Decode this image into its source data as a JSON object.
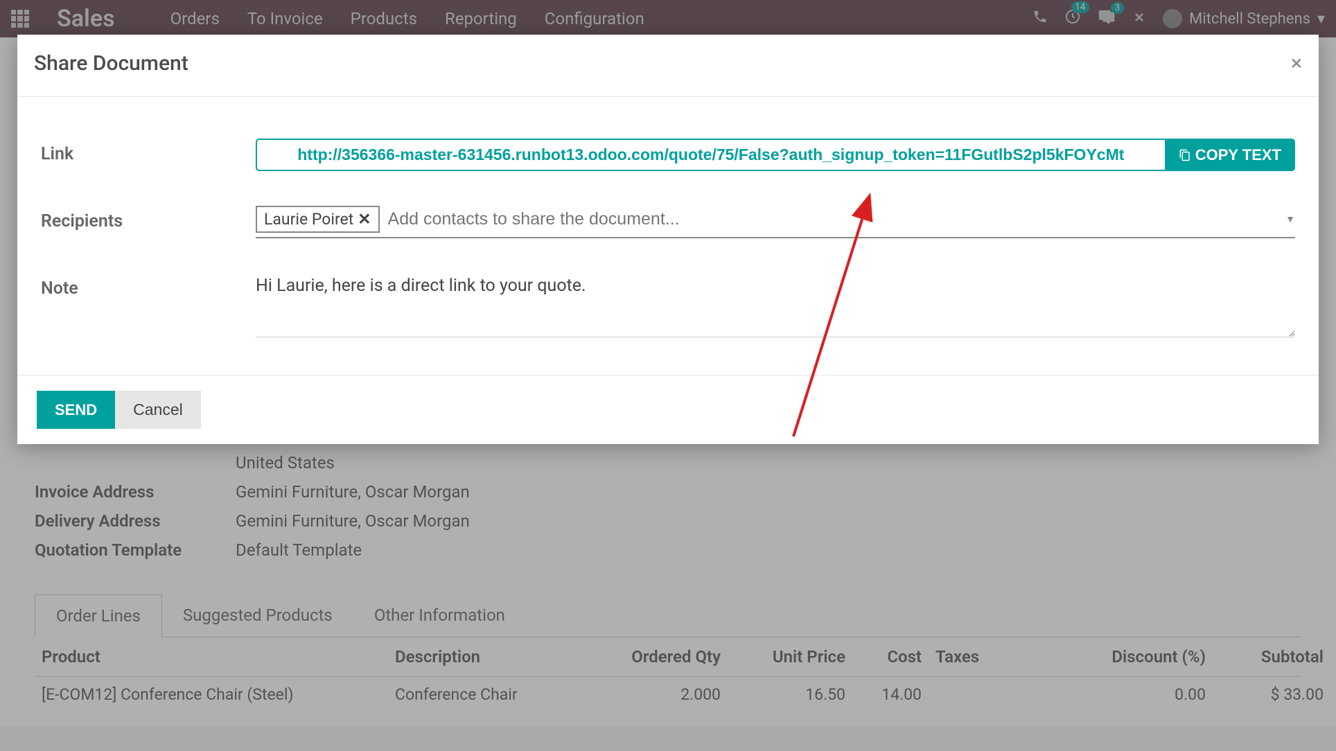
{
  "nav": {
    "app_title": "Sales",
    "menu": [
      "Orders",
      "To Invoice",
      "Products",
      "Reporting",
      "Configuration"
    ],
    "badges": {
      "activities": "14",
      "messages": "3"
    },
    "user": "Mitchell Stephens"
  },
  "modal": {
    "title": "Share Document",
    "link_label": "Link",
    "link_url": "http://356366-master-631456.runbot13.odoo.com/quote/75/False?auth_signup_token=11FGutlbS2pl5kFOYcMt",
    "copy_label": "COPY TEXT",
    "recipients_label": "Recipients",
    "recipients": [
      "Laurie Poiret"
    ],
    "recipients_placeholder": "Add contacts to share the document...",
    "note_label": "Note",
    "note_value": "Hi Laurie, here is a direct link to your quote.",
    "send_label": "SEND",
    "cancel_label": "Cancel"
  },
  "background": {
    "country": "United States",
    "invoice_address_label": "Invoice Address",
    "invoice_address": "Gemini Furniture, Oscar Morgan",
    "delivery_address_label": "Delivery Address",
    "delivery_address": "Gemini Furniture, Oscar Morgan",
    "quotation_template_label": "Quotation Template",
    "quotation_template": "Default Template",
    "tabs": [
      "Order Lines",
      "Suggested Products",
      "Other Information"
    ],
    "table": {
      "headers": {
        "product": "Product",
        "description": "Description",
        "ordered_qty": "Ordered Qty",
        "unit_price": "Unit Price",
        "cost": "Cost",
        "taxes": "Taxes",
        "discount": "Discount (%)",
        "subtotal": "Subtotal"
      },
      "rows": [
        {
          "product": "[E-COM12] Conference Chair (Steel)",
          "description": "Conference Chair",
          "qty": "2.000",
          "price": "16.50",
          "cost": "14.00",
          "taxes": "",
          "discount": "0.00",
          "subtotal": "$ 33.00"
        }
      ]
    }
  }
}
